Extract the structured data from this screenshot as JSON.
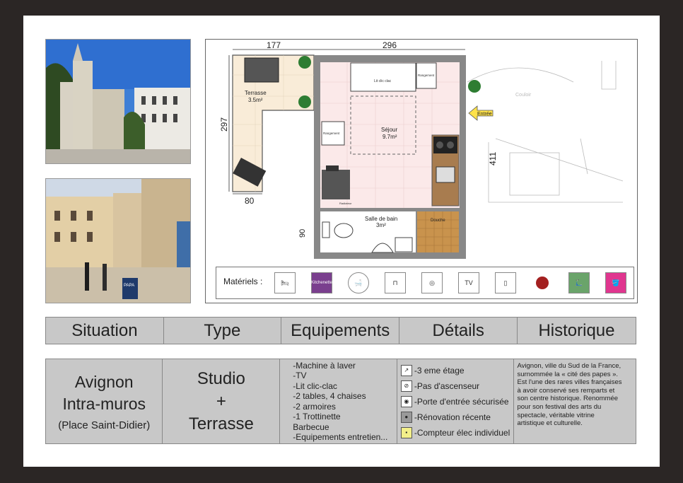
{
  "plan": {
    "dim_top_left": "177",
    "dim_top_right": "296",
    "dim_left": "297",
    "dim_bottom": "80",
    "dim_right": "411",
    "dim_bath_left": "90",
    "terrace_name": "Terrasse",
    "terrace_area": "3.5m²",
    "living_name": "Séjour",
    "living_area": "9.7m²",
    "bath_name": "Salle de bain",
    "bath_area": "3m²",
    "shower": "Douche",
    "storage_a": "Rangement",
    "storage_b": "Rangement",
    "bed": "Lit clic clac",
    "towel": "Radiateur",
    "corridor": "Couloir",
    "entry": "Entrée"
  },
  "materials": {
    "label": "Matériels :",
    "items": [
      {
        "icon": "bed-icon"
      },
      {
        "icon": "kitchenette-icon",
        "text": "Kitchenette",
        "color": "#7a3f8e"
      },
      {
        "icon": "bathroom-icon"
      },
      {
        "icon": "table-icon"
      },
      {
        "icon": "washing-machine-icon"
      },
      {
        "icon": "tv-icon",
        "text": "TV"
      },
      {
        "icon": "wardrobe-icon"
      },
      {
        "icon": "barbecue-icon"
      },
      {
        "icon": "scooter-icon",
        "color": "#6aa46a"
      },
      {
        "icon": "cleaning-icon",
        "color": "#e0368f"
      }
    ]
  },
  "headers": [
    "Situation",
    "Type",
    "Equipements",
    "Détails",
    "Historique"
  ],
  "situation": {
    "line1": "Avignon",
    "line2": "Intra-muros",
    "line3": "(Place Saint-Didier)"
  },
  "type": {
    "line1": "Studio",
    "line2": "+",
    "line3": "Terrasse"
  },
  "equipements": [
    "-Machine à laver",
    "-TV",
    "-Lit clic-clac",
    "-2 tables, 4 chaises",
    "-2 armoires",
    "-1 Trottinette",
    "Barbecue",
    "-Equipements entretien..."
  ],
  "details": [
    {
      "icon": "stairs-icon",
      "text": "-3 eme étage"
    },
    {
      "icon": "no-elevator-icon",
      "text": "-Pas d'ascenseur"
    },
    {
      "icon": "lock-icon",
      "text": "-Porte d'entrée sécurisée"
    },
    {
      "icon": "renovation-icon",
      "text": "-Rénovation récente"
    },
    {
      "icon": "meter-icon",
      "text": "-Compteur élec individuel"
    }
  ],
  "historique": [
    "Avignon, ville du Sud de la France,",
    "surnommée la « cité des papes ».",
    "Est l'une des rares villes françaises",
    "à avoir conservé ses remparts et",
    "son centre historique. Renommée",
    "pour son festival des arts du",
    "spectacle, véritable vitrine",
    "artistique et culturelle."
  ],
  "photo2_sign": "PAPA"
}
